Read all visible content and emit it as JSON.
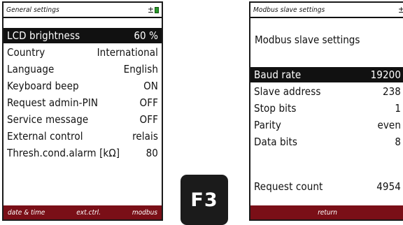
{
  "left": {
    "title": "General settings",
    "rows": [
      {
        "label": "LCD brightness",
        "value": "60 %"
      },
      {
        "label": "Country",
        "value": "International"
      },
      {
        "label": "Language",
        "value": "English"
      },
      {
        "label": "Keyboard beep",
        "value": "ON"
      },
      {
        "label": "Request admin-PIN",
        "value": "OFF"
      },
      {
        "label": "Service message",
        "value": "OFF"
      },
      {
        "label": "External control",
        "value": "relais"
      },
      {
        "label": "Thresh.cond.alarm [kΩ]",
        "value": "80"
      }
    ],
    "softkeys": [
      "date & time",
      "ext.ctrl.",
      "modbus"
    ]
  },
  "key": {
    "label": "F3"
  },
  "right": {
    "title": "Modbus slave settings",
    "subtitle": "Modbus slave settings",
    "rows": [
      {
        "label": "Baud rate",
        "value": "19200"
      },
      {
        "label": "Slave address",
        "value": "238"
      },
      {
        "label": "Stop bits",
        "value": "1"
      },
      {
        "label": "Parity",
        "value": "even"
      },
      {
        "label": "Data bits",
        "value": "8"
      },
      {
        "label": "Request count",
        "value": "4954"
      }
    ],
    "softkeys": [
      "return"
    ]
  },
  "colors": {
    "softbar": "#7a0f17",
    "led": "#2b9a2b",
    "selected": "#111111"
  },
  "icons": {
    "status": [
      "plug-icon",
      "status-led-icon"
    ]
  }
}
